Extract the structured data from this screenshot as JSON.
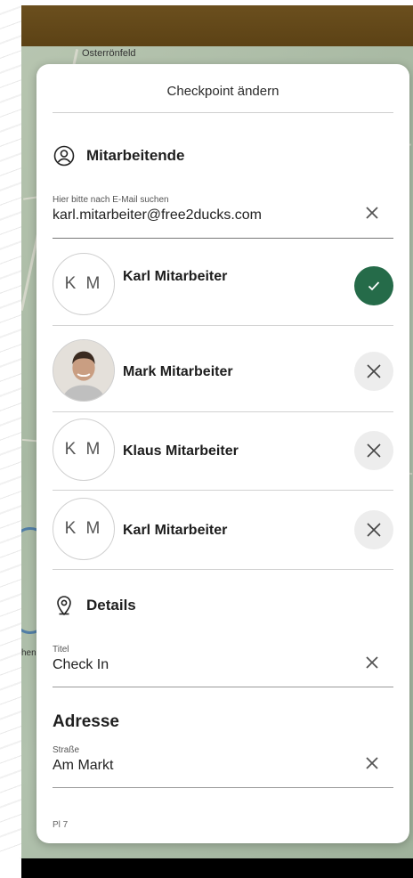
{
  "map": {
    "place_label": "Osterrönfeld",
    "side_label": "hen"
  },
  "dialog": {
    "title": "Checkpoint ändern"
  },
  "employees": {
    "section_label": "Mitarbeitende",
    "section_icon": "user-circle-icon",
    "search": {
      "label": "Hier bitte nach E-Mail suchen",
      "value": "karl.mitarbeiter@free2ducks.com"
    },
    "people": [
      {
        "initials": "K M",
        "name": "Karl Mitarbeiter",
        "status": "selected"
      },
      {
        "initials": "",
        "name": "Mark Mitarbeiter",
        "status": "removable",
        "has_photo": true
      },
      {
        "initials": "K M",
        "name": "Klaus Mitarbeiter",
        "status": "removable"
      },
      {
        "initials": "K M",
        "name": "Karl Mitarbeiter",
        "status": "removable"
      }
    ]
  },
  "details": {
    "section_label": "Details",
    "section_icon": "location-pin-icon",
    "title_field": {
      "label": "Titel",
      "value": "Check In"
    }
  },
  "address": {
    "heading": "Adresse",
    "street_field": {
      "label": "Straße",
      "value": "Am Markt"
    },
    "plz_label": "Pl 7"
  },
  "colors": {
    "accent_green": "#256b49",
    "topbar": "#6b4f1e"
  }
}
